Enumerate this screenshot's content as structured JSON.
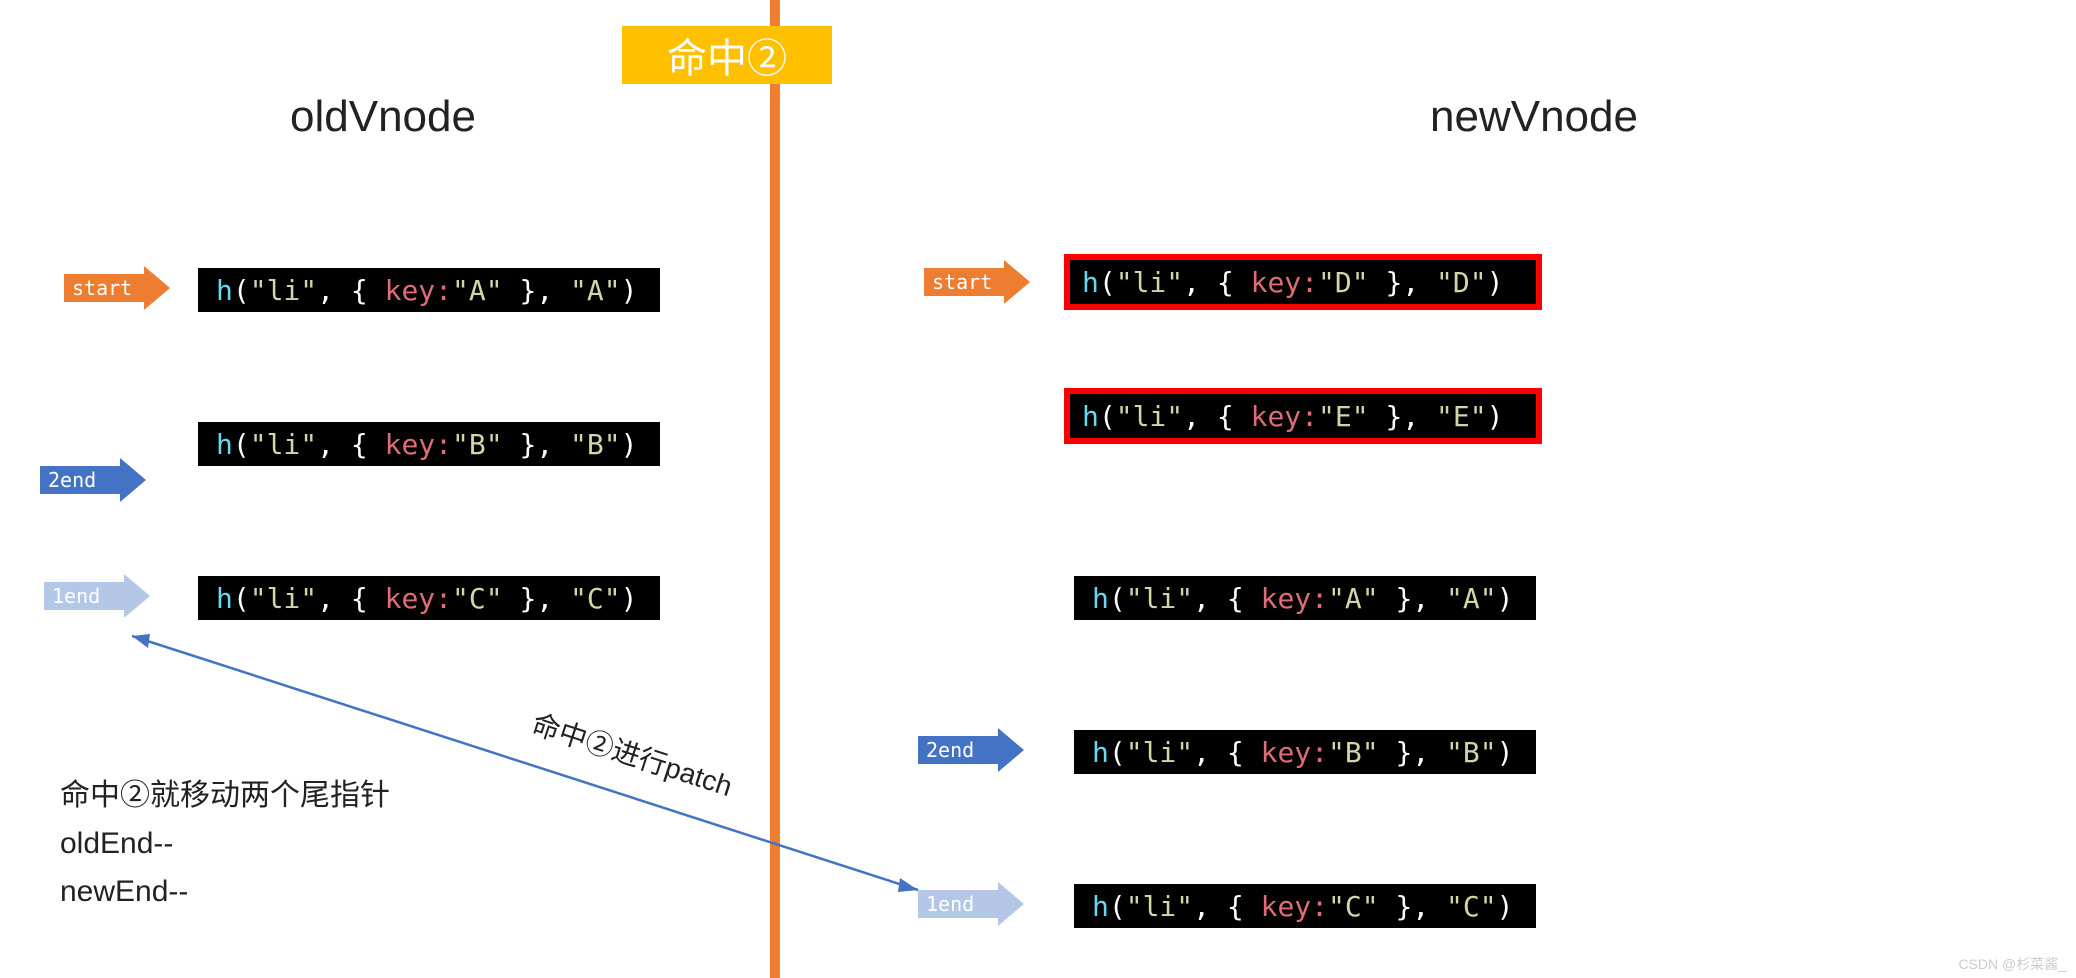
{
  "badge": "命中②",
  "titles": {
    "left": "oldVnode",
    "right": "newVnode"
  },
  "pointers": {
    "start": "start",
    "end2": "2end",
    "end1": "1end"
  },
  "code": {
    "old": [
      {
        "fn": "h",
        "arg1": "\"li\"",
        "keyword": "key",
        "kval": "\"A\"",
        "child": "\"A\""
      },
      {
        "fn": "h",
        "arg1": "\"li\"",
        "keyword": "key",
        "kval": "\"B\"",
        "child": "\"B\""
      },
      {
        "fn": "h",
        "arg1": "\"li\"",
        "keyword": "key",
        "kval": "\"C\"",
        "child": "\"C\""
      }
    ],
    "new": [
      {
        "fn": "h",
        "arg1": "\"li\"",
        "keyword": "key",
        "kval": "\"D\"",
        "child": "\"D\"",
        "highlighted": true
      },
      {
        "fn": "h",
        "arg1": "\"li\"",
        "keyword": "key",
        "kval": "\"E\"",
        "child": "\"E\"",
        "highlighted": true
      },
      {
        "fn": "h",
        "arg1": "\"li\"",
        "keyword": "key",
        "kval": "\"A\"",
        "child": "\"A\"",
        "highlighted": false
      },
      {
        "fn": "h",
        "arg1": "\"li\"",
        "keyword": "key",
        "kval": "\"B\"",
        "child": "\"B\"",
        "highlighted": false
      },
      {
        "fn": "h",
        "arg1": "\"li\"",
        "keyword": "key",
        "kval": "\"C\"",
        "child": "\"C\"",
        "highlighted": false
      }
    ]
  },
  "connector_label": "命中②进行patch",
  "note_lines": [
    "命中②就移动两个尾指针",
    "oldEnd--",
    "newEnd--"
  ],
  "watermark": "CSDN @杉菜酱_"
}
